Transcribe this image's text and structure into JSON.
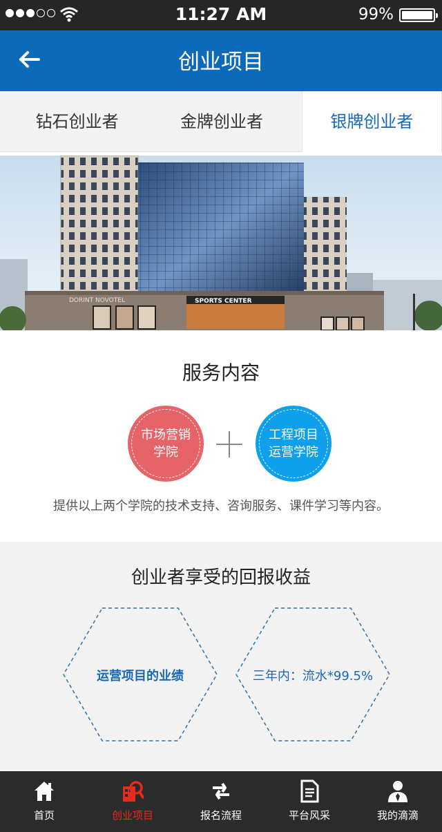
{
  "status_bar": {
    "time": "11:27 AM",
    "battery": "99%",
    "battery_level": 0.99,
    "signal_bars": 3
  },
  "nav": {
    "title": "创业项目",
    "back_icon": "arrow-left-icon"
  },
  "tabs": [
    {
      "label": "钻石创业者",
      "active": false
    },
    {
      "label": "金牌创业者",
      "active": false
    },
    {
      "label": "银牌创业者",
      "active": true
    }
  ],
  "hero": {
    "sign_text": "SPORTS CENTER",
    "facade_text": "DORINT NOVOTEL"
  },
  "services": {
    "title": "服务内容",
    "items": [
      {
        "line1": "市场营销",
        "line2": "学院",
        "color": "#e66468"
      },
      {
        "line1": "工程项目",
        "line2": "运营学院",
        "color": "#0ea0ea"
      }
    ],
    "description": "提供以上两个学院的技术支持、咨询服务、课件学习等内容。"
  },
  "returns": {
    "title": "创业者享受的回报收益",
    "items": [
      {
        "text": "运营项目的业绩"
      },
      {
        "text": "三年内：流水*99.5%"
      }
    ]
  },
  "tab_bar": {
    "items": [
      {
        "label": "首页",
        "icon": "home-icon",
        "active": false
      },
      {
        "label": "创业项目",
        "icon": "project-search-icon",
        "active": true
      },
      {
        "label": "报名流程",
        "icon": "swap-arrows-icon",
        "active": false
      },
      {
        "label": "平台风采",
        "icon": "document-icon",
        "active": false
      },
      {
        "label": "我的滴滴",
        "icon": "user-profile-icon",
        "active": false
      }
    ]
  },
  "colors": {
    "primary": "#0d6ab8",
    "accent_active": "#e62a1d",
    "red_circle": "#e66468",
    "blue_circle": "#0ea0ea"
  }
}
